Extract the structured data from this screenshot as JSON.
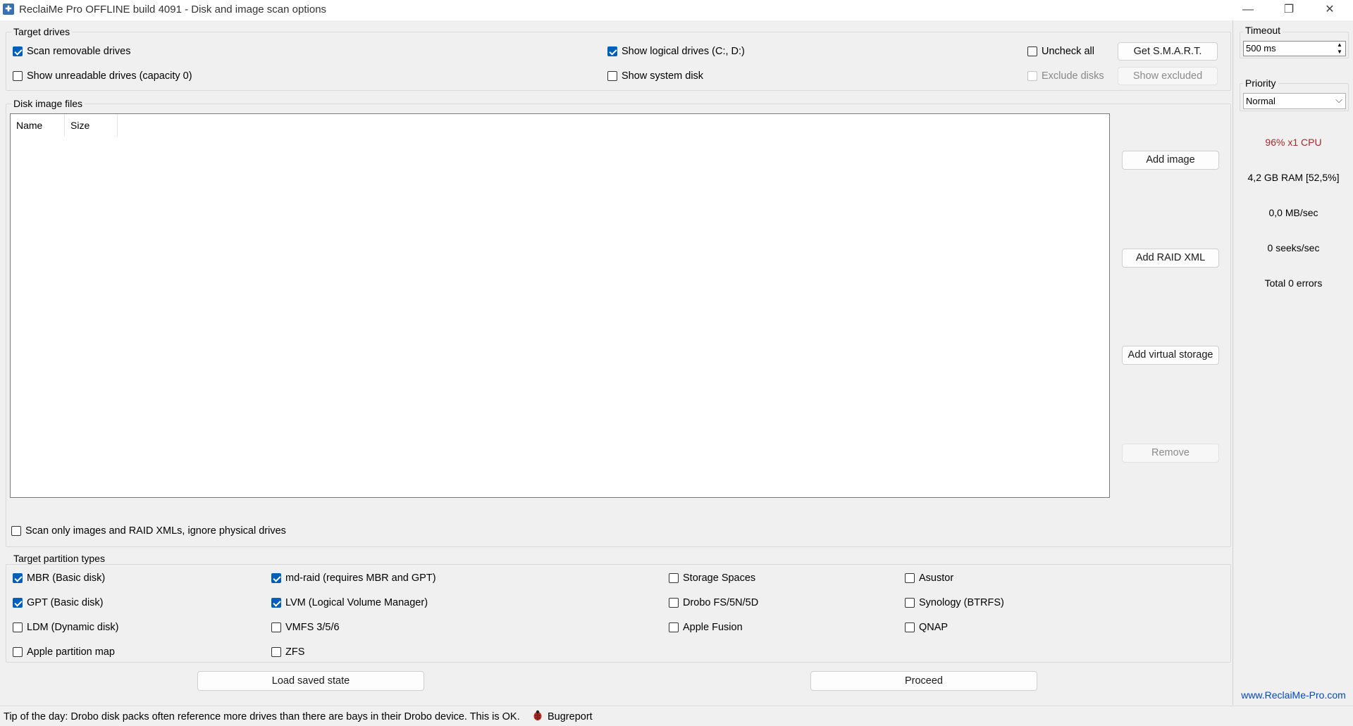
{
  "window": {
    "title": "ReclaiMe Pro OFFLINE build 4091 - Disk and image scan options",
    "icon": "app-icon",
    "minimize_glyph": "—",
    "restore_glyph": "❐",
    "close_glyph": "✕"
  },
  "target_drives": {
    "title": "Target drives",
    "scan_removable": "Scan removable drives",
    "show_unreadable": "Show unreadable drives (capacity 0)",
    "show_logical": "Show logical drives (C:, D:)",
    "show_system": "Show system disk",
    "uncheck_all": "Uncheck all",
    "exclude_disks": "Exclude disks",
    "get_smart": "Get S.M.A.R.T.",
    "show_excluded": "Show excluded"
  },
  "disk_images": {
    "title": "Disk image files",
    "columns": [
      "Name",
      "Size"
    ],
    "add_image": "Add image",
    "add_raid_xml": "Add RAID XML",
    "add_virtual_storage": "Add virtual storage",
    "remove": "Remove",
    "scan_only_images": "Scan only images and RAID XMLs, ignore physical drives"
  },
  "partition_types": {
    "title": "Target partition types",
    "items": [
      {
        "label": "MBR (Basic disk)",
        "checked": true
      },
      {
        "label": "GPT (Basic disk)",
        "checked": true
      },
      {
        "label": "LDM (Dynamic disk)",
        "checked": false
      },
      {
        "label": "Apple partition map",
        "checked": false
      },
      {
        "label": "md-raid (requires MBR and GPT)",
        "checked": true
      },
      {
        "label": "LVM (Logical Volume Manager)",
        "checked": true
      },
      {
        "label": "VMFS 3/5/6",
        "checked": false
      },
      {
        "label": "ZFS",
        "checked": false
      },
      {
        "label": "Storage Spaces",
        "checked": false
      },
      {
        "label": "Drobo FS/5N/5D",
        "checked": false
      },
      {
        "label": "Apple Fusion",
        "checked": false
      },
      {
        "label": "Asustor",
        "checked": false
      },
      {
        "label": "Synology (BTRFS)",
        "checked": false
      },
      {
        "label": "QNAP",
        "checked": false
      }
    ]
  },
  "actions": {
    "load_saved_state": "Load saved state",
    "proceed": "Proceed"
  },
  "right_panel": {
    "timeout_title": "Timeout",
    "timeout_value": "500 ms",
    "priority_title": "Priority",
    "priority_value": "Normal",
    "cpu": "96% x1 CPU",
    "cpu_color": "#a52a2a",
    "ram": "4,2 GB RAM [52,5%]",
    "throughput": "0,0 MB/sec",
    "seeks": "0 seeks/sec",
    "errors": "Total 0 errors",
    "website": "www.ReclaiMe-Pro.com",
    "link_color": "#0046d5"
  },
  "status": {
    "tip": "Tip of the day: Drobo disk packs often reference more drives than there are bays in their Drobo device. This is OK.",
    "bugreport": "Bugreport",
    "bug_icon": "ladybug-icon"
  }
}
